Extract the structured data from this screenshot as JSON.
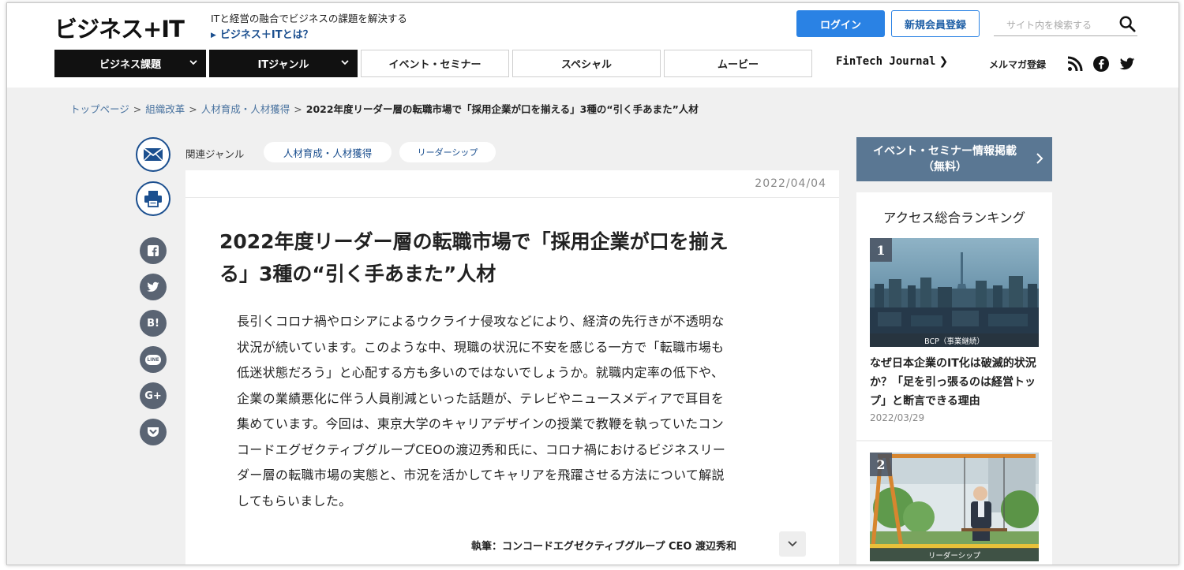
{
  "header": {
    "logo": "ビジネス+IT",
    "tagline": "ITと経営の融合でビジネスの課題を解決する",
    "about_link": "ビジネス＋ITとは？",
    "login_label": "ログイン",
    "register_label": "新規会員登録",
    "search_placeholder": "サイト内を検索する",
    "nav": [
      {
        "label": "ビジネス課題"
      },
      {
        "label": "ITジャンル"
      },
      {
        "label": "イベント・セミナー"
      },
      {
        "label": "スペシャル"
      },
      {
        "label": "ムービー"
      }
    ],
    "fintech": "FinTech Journal",
    "mailmag": "メルマガ登録"
  },
  "breadcrumb": {
    "items": [
      "トップページ",
      "組織改革",
      "人材育成・人材獲得"
    ],
    "current": "2022年度リーダー層の転職市場で「採用企業が口を揃える」3種の“引く手あまた”人材"
  },
  "article": {
    "genre_label": "関連ジャンル",
    "genres": [
      "人材育成・人材獲得",
      "リーダーシップ"
    ],
    "date": "2022/04/04",
    "title_line1": "2022年度リーダー層の転職市場で「採用企業が口を揃え",
    "title_line2": "る」3種の“引く手あまた”人材",
    "lead": [
      "長引くコロナ禍やロシアによるウクライナ侵攻などにより、経済の先行きが不透明な",
      "状況が続いています。このような中、現職の状況に不安を感じる一方で「転職市場も",
      "低迷状態だろう」と心配する方も多いのではないでしょうか。就職内定率の低下や、",
      "企業の業績悪化に伴う人員削減といった話題が、テレビやニュースメディアで耳目を",
      "集めています。今回は、東京大学のキャリアデザインの授業で教鞭を執っていたコン",
      "コードエグゼクティブグループCEOの渡辺秀和氏に、コロナ禍におけるビジネスリー",
      "ダー層の転職市場の実態と、市況を活かしてキャリアを飛躍させる方法について解説",
      "してもらいました。"
    ],
    "author": "執筆：コンコードエグゼクティブグループ CEO 渡辺秀和"
  },
  "share": {
    "hatena_label": "B!",
    "line_label": "LINE",
    "gplus_label": "G+"
  },
  "sidebar": {
    "event_banner_line1": "イベント・セミナー情報掲載",
    "event_banner_line2": "（無料）",
    "ranking_title": "アクセス総合ランキング",
    "ranking": [
      {
        "rank": "1",
        "category": "BCP（事業継続）",
        "headline": "なぜ日本企業のIT化は破滅的状況か？「足を引っ張るのは経営トップ」と断言できる理由",
        "date": "2022/03/29"
      },
      {
        "rank": "2",
        "category": "リーダーシップ"
      }
    ]
  },
  "colors": {
    "login_blue": "#2a82e4",
    "link_blue": "#1b4f8f",
    "nav_dark": "#111111",
    "banner": "#5a7793",
    "share_gray": "#5a6473"
  }
}
